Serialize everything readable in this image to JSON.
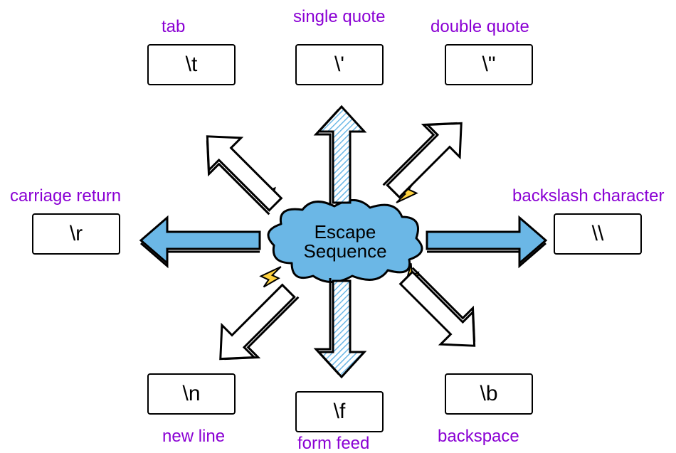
{
  "center": {
    "line1": "Escape",
    "line2": "Sequence"
  },
  "items": [
    {
      "key": "tab",
      "label": "tab",
      "code": "\\t"
    },
    {
      "key": "single_quote",
      "label": "single quote",
      "code": "\\'"
    },
    {
      "key": "double_quote",
      "label": "double quote",
      "code": "\\\""
    },
    {
      "key": "backslash",
      "label": "backslash character",
      "code": "\\\\"
    },
    {
      "key": "backspace",
      "label": "backspace",
      "code": "\\b"
    },
    {
      "key": "form_feed",
      "label": "form feed",
      "code": "\\f"
    },
    {
      "key": "new_line",
      "label": "new line",
      "code": "\\n"
    },
    {
      "key": "carriage_return",
      "label": "carriage return",
      "code": "\\r"
    }
  ]
}
